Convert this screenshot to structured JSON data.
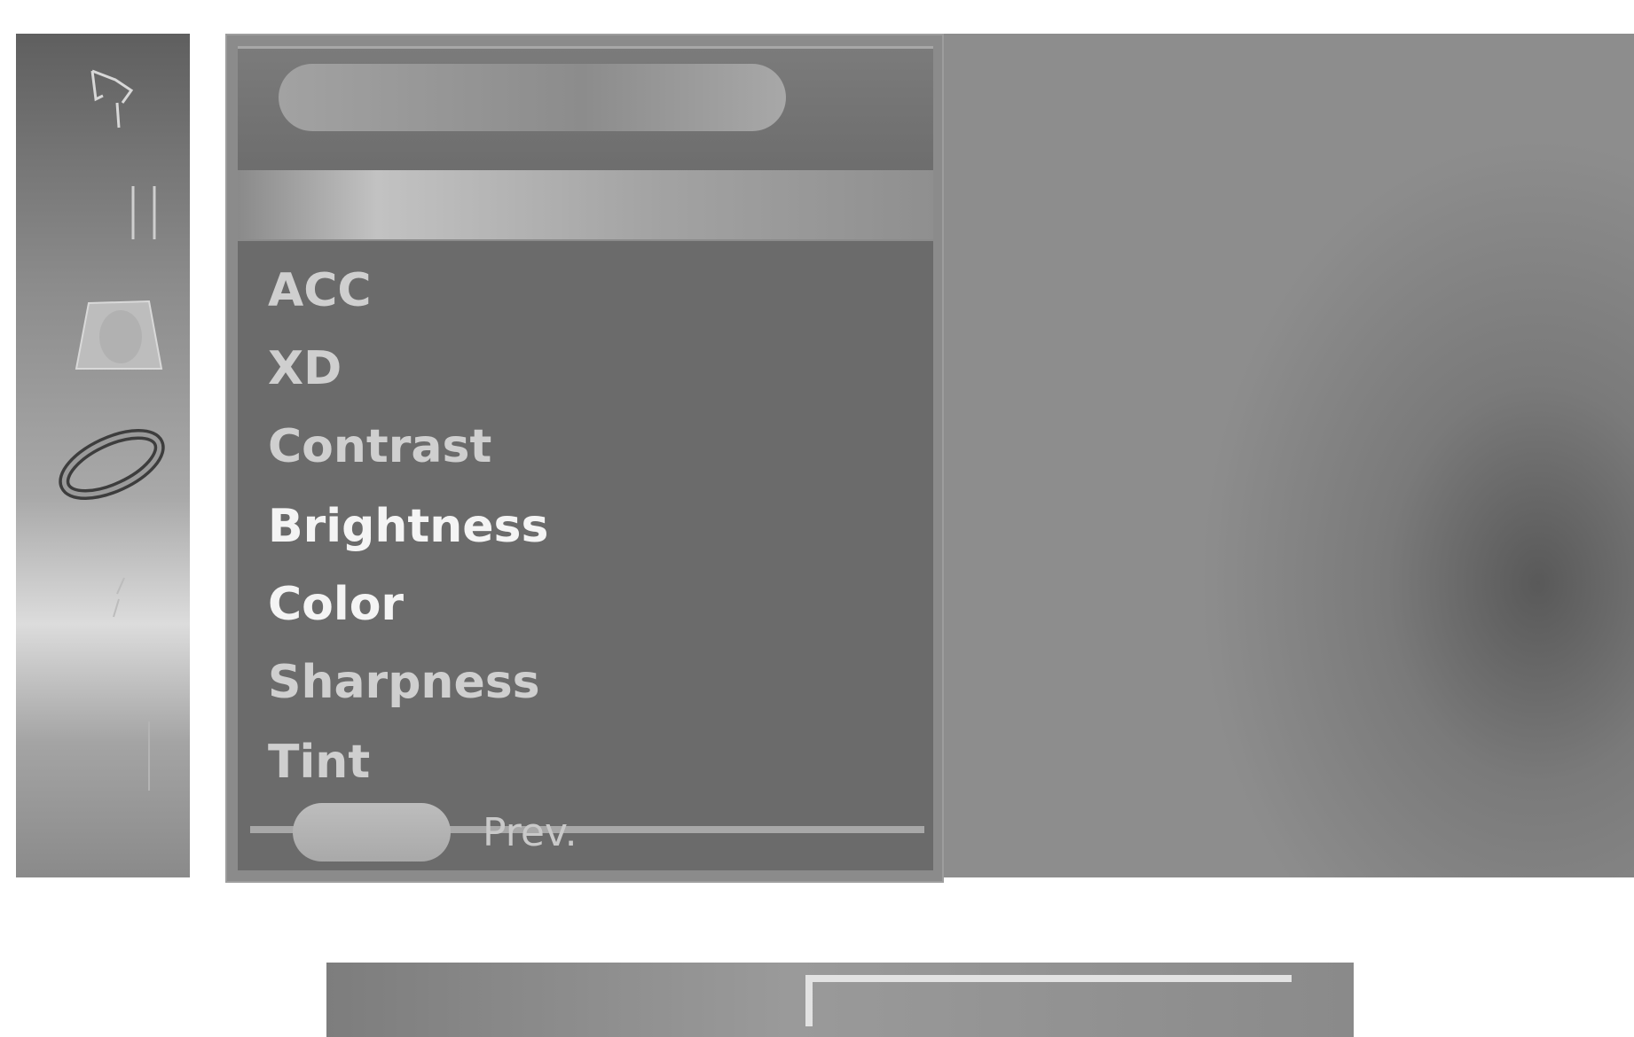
{
  "sidebar": {
    "icons": [
      {
        "name": "setup-icon"
      },
      {
        "name": "video-icon"
      },
      {
        "name": "audio-icon"
      },
      {
        "name": "time-icon"
      },
      {
        "name": "special-icon"
      },
      {
        "name": "screen-icon"
      }
    ]
  },
  "menu": {
    "items": [
      {
        "label": "ACC",
        "dim": true
      },
      {
        "label": "XD",
        "dim": true
      },
      {
        "label": "Contrast",
        "dim": true
      },
      {
        "label": "Brightness",
        "dim": false
      },
      {
        "label": "Color",
        "dim": false
      },
      {
        "label": "Sharpness",
        "dim": true
      },
      {
        "label": "Tint",
        "dim": true
      }
    ]
  },
  "footer": {
    "prev_label": "Prev."
  },
  "colors": {
    "panel": "#6b6b6b",
    "text_bright": "#f4f4f4",
    "text_dim": "#cfcfcf"
  }
}
